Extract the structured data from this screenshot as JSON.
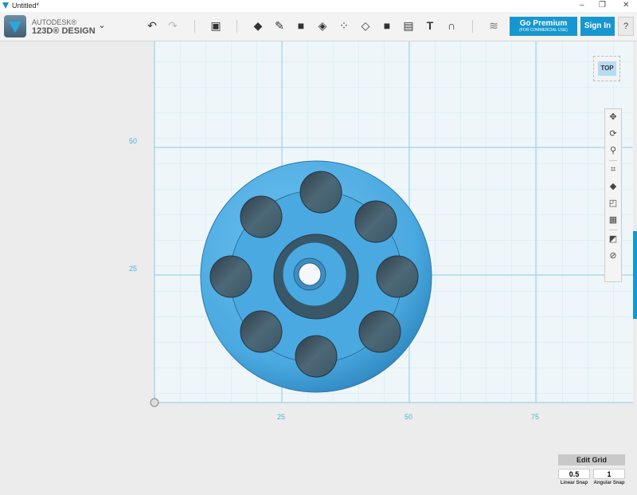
{
  "window": {
    "title": "Untitled*",
    "minimize": "–",
    "restore": "❐",
    "close": "✕"
  },
  "app": {
    "brand_top": "AUTODESK®",
    "brand_bottom": "123D® DESIGN",
    "menu_icon": "chevron-down-icon"
  },
  "toolbar": {
    "undo": "↶",
    "redo": "↷",
    "tools": [
      "primitives-icon",
      "sketch-icon",
      "construct-icon",
      "modify-icon",
      "pattern-icon",
      "grouping-icon",
      "combine-icon",
      "measure-icon",
      "text-icon",
      "snap-icon"
    ],
    "materials": "material-icon",
    "go_premium": "Go Premium",
    "go_premium_sub": "(FOR COMMERCIAL USE)",
    "sign_in": "Sign In",
    "help": "?"
  },
  "viewport": {
    "x_ticks": [
      "25",
      "50",
      "75"
    ],
    "y_ticks": [
      "50",
      "25"
    ],
    "view_cube": "TOP",
    "grid_color": "#bfe2ef",
    "model_color": "#4aa9e0"
  },
  "nav": [
    "pan-icon",
    "orbit-icon",
    "zoom-icon",
    "fit-icon",
    "perspective-icon",
    "materials-outlines-icon",
    "grid-icon",
    "hide-sketches-icon",
    "hide-meshes-icon"
  ],
  "grid_panel": {
    "edit_grid": "Edit Grid",
    "linear_snap": "0.5",
    "angular_snap": "1",
    "linear_label": "Linear Snap",
    "angular_label": "Angular Snap"
  }
}
